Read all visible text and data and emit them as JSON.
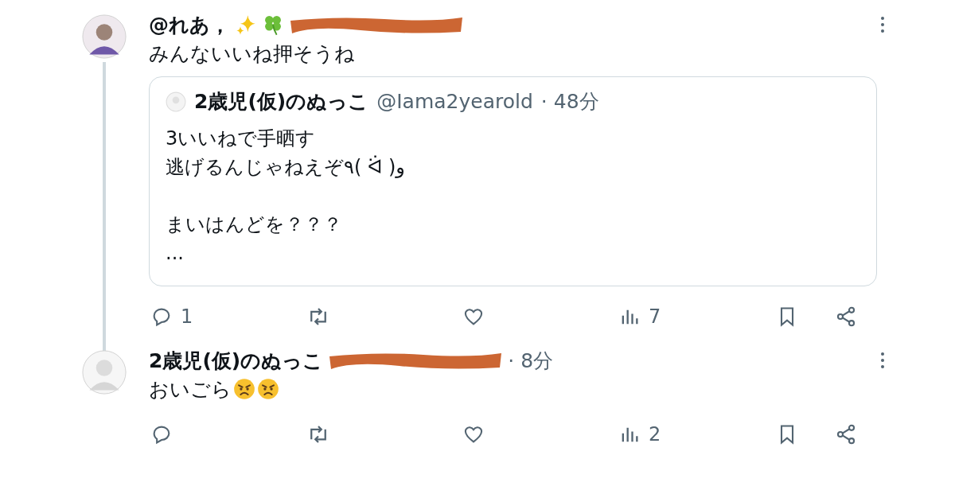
{
  "tweets": [
    {
      "name": "@れあ，",
      "handle_redacted": true,
      "body": [
        "みんないいね押そうね"
      ],
      "quote": {
        "name": "2歳児(仮)のぬっこ",
        "handle": "@Iama2yearold",
        "time": "· 48分",
        "paragraphs": [
          [
            "3いいねで手晒す",
            "逃げるんじゃねえぞ٩( ᐛ )و"
          ],
          [
            "まいはんどを？？？",
            "..."
          ]
        ]
      },
      "actions": {
        "replies": "1",
        "views": "7"
      }
    },
    {
      "name": "2歳児(仮)のぬっこ",
      "handle_redacted": true,
      "time": "· 8分",
      "body": [
        "おいごら"
      ],
      "actions": {
        "views": "2"
      }
    }
  ]
}
